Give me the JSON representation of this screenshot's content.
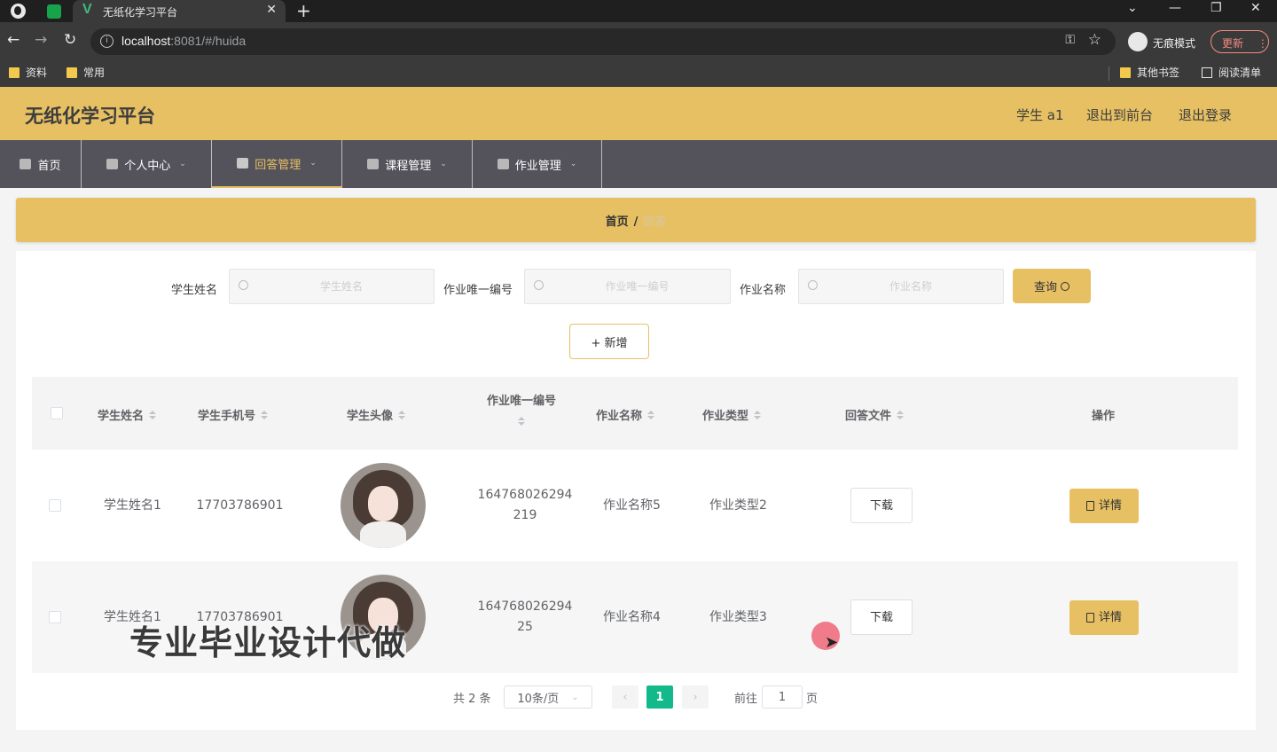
{
  "browser": {
    "tab_title": "无纸化学习平台",
    "url_host": "localhost",
    "url_rest": ":8081/#/huida",
    "incognito_label": "无痕模式",
    "update_label": "更新",
    "bookmarks": [
      "资料",
      "常用"
    ],
    "other_bookmarks": "其他书签",
    "reading_list": "阅读清单"
  },
  "header": {
    "title": "无纸化学习平台",
    "user": "学生 a1",
    "to_front": "退出到前台",
    "logout": "退出登录"
  },
  "menu": {
    "items": [
      {
        "label": "首页"
      },
      {
        "label": "个人中心"
      },
      {
        "label": "回答管理"
      },
      {
        "label": "课程管理"
      },
      {
        "label": "作业管理"
      }
    ]
  },
  "breadcrumb": {
    "home": "首页",
    "separator": "/",
    "current": "回答"
  },
  "filters": {
    "student_name_label": "学生姓名",
    "student_name_placeholder": "学生姓名",
    "hw_id_label": "作业唯一编号",
    "hw_id_placeholder": "作业唯一编号",
    "hw_name_label": "作业名称",
    "hw_name_placeholder": "作业名称",
    "query_label": "查询",
    "add_label": "+ 新增"
  },
  "table": {
    "columns": [
      "学生姓名",
      "学生手机号",
      "学生头像",
      "作业唯一编号",
      "作业名称",
      "作业类型",
      "回答文件",
      "操作"
    ],
    "rows": [
      {
        "name": "学生姓名1",
        "phone": "17703786901",
        "hw_id_line1": "164768026294",
        "hw_id_line2": "219",
        "hw_name": "作业名称5",
        "hw_type": "作业类型2",
        "download": "下载",
        "detail": "详情"
      },
      {
        "name": "学生姓名1",
        "phone": "17703786901",
        "hw_id_line1": "164768026294",
        "hw_id_line2": "25",
        "hw_name": "作业名称4",
        "hw_type": "作业类型3",
        "download": "下载",
        "detail": "详情"
      }
    ]
  },
  "pagination": {
    "total": "共 2 条",
    "page_size": "10条/页",
    "current_page": "1",
    "goto_label": "前往",
    "goto_value": "1",
    "page_suffix": "页"
  },
  "watermark": "专业毕业设计代做",
  "colors": {
    "accent": "#e7c064",
    "menu_bg": "#54525a",
    "page_active": "#13b98a"
  }
}
